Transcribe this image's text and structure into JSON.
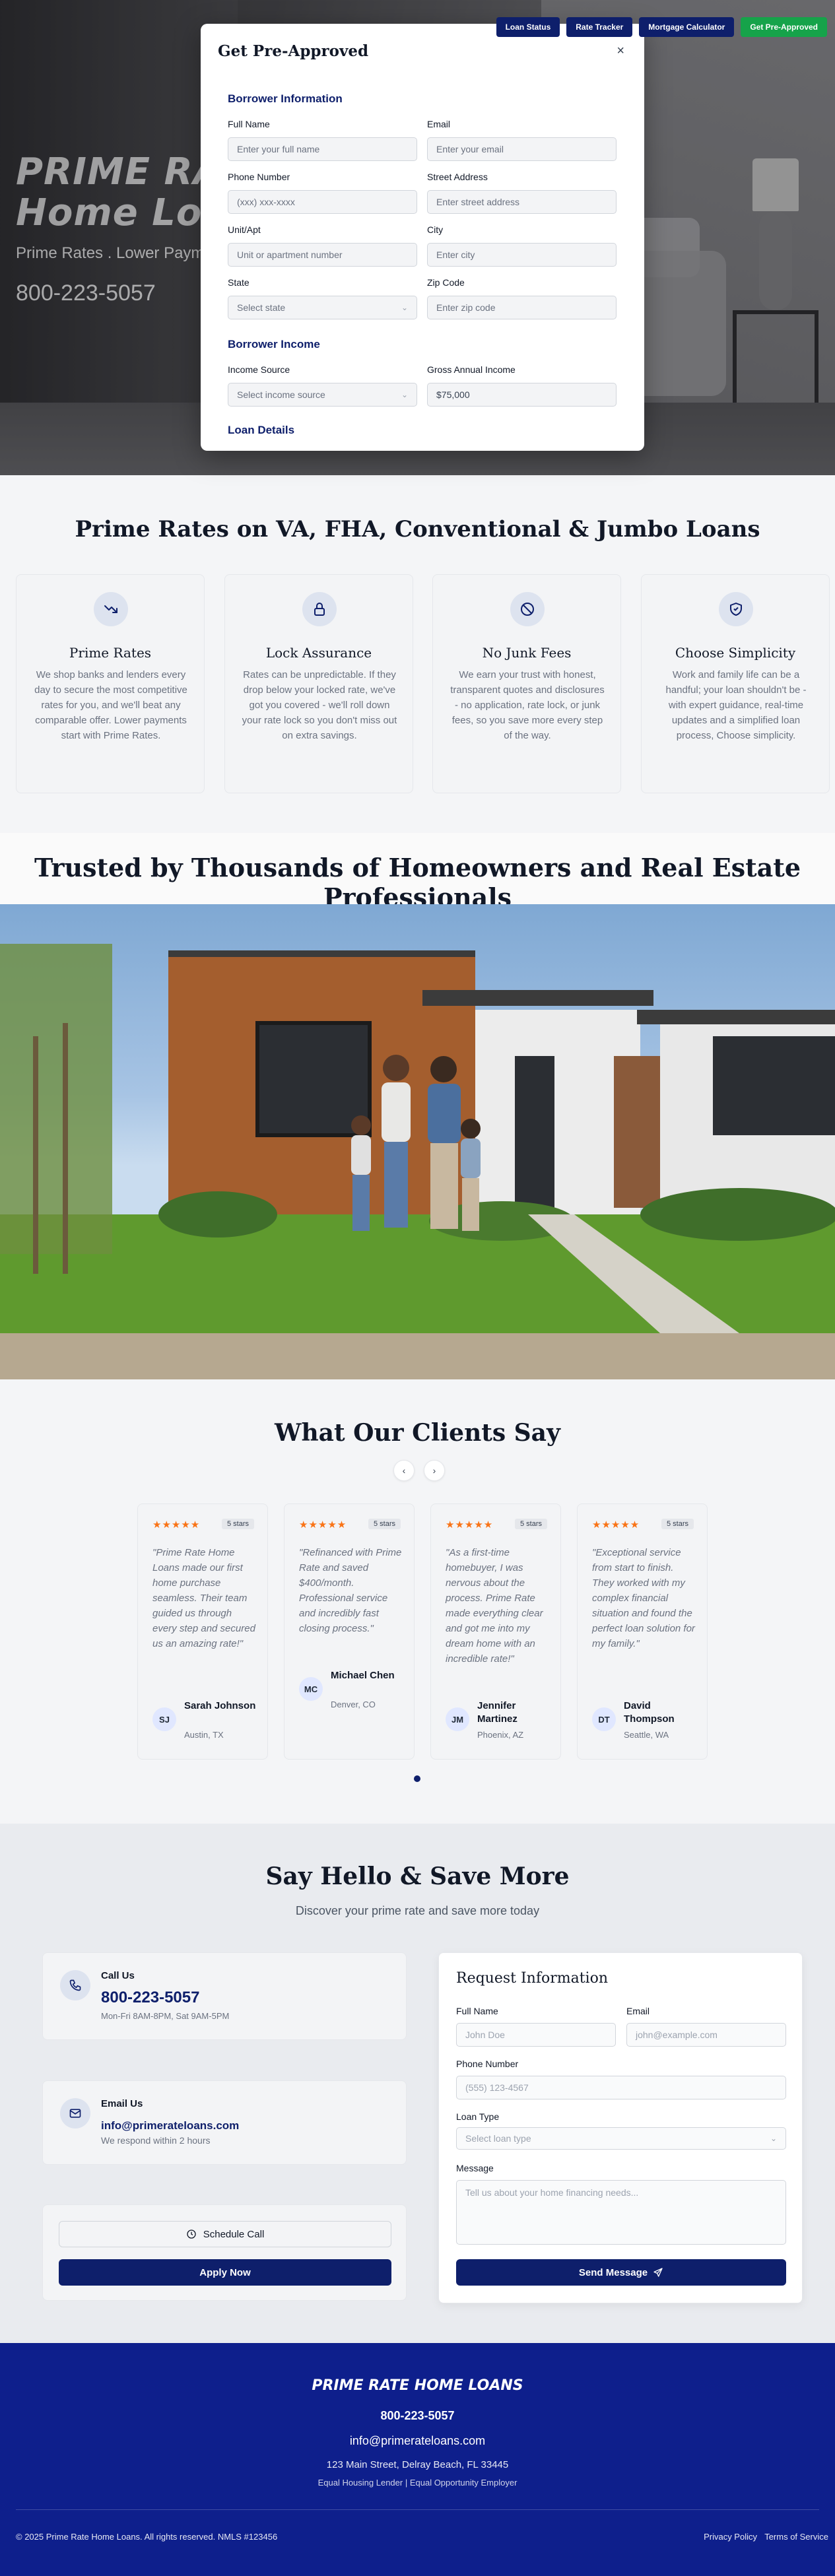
{
  "nav": {
    "loan_status": "Loan Status",
    "rate_tracker": "Rate Tracker",
    "mortgage_calculator": "Mortgage Calculator",
    "get_pre_approved": "Get Pre-Approved"
  },
  "hero": {
    "title_line1": "PRIME RA",
    "title_line2": "Home Loa",
    "subtitle": "Prime Rates . Lower Paym",
    "phone": "800-223-5057"
  },
  "modal": {
    "title": "Get Pre-Approved",
    "close": "×",
    "section_borrower": "Borrower Information",
    "full_name_label": "Full Name",
    "full_name_placeholder": "Enter your full name",
    "email_label": "Email",
    "email_placeholder": "Enter your email",
    "phone_label": "Phone Number",
    "phone_placeholder": "(xxx) xxx-xxxx",
    "street_label": "Street Address",
    "street_placeholder": "Enter street address",
    "unit_label": "Unit/Apt",
    "unit_placeholder": "Unit or apartment number",
    "city_label": "City",
    "city_placeholder": "Enter city",
    "state_label": "State",
    "state_placeholder": "Select state",
    "zip_label": "Zip Code",
    "zip_placeholder": "Enter zip code",
    "section_income": "Borrower Income",
    "income_source_label": "Income Source",
    "income_source_placeholder": "Select income source",
    "gross_income_label": "Gross Annual Income",
    "gross_income_value": "$75,000",
    "section_loan": "Loan Details"
  },
  "features": {
    "title": "Prime Rates on VA, FHA, Conventional & Jumbo Loans",
    "cards": [
      {
        "icon": "trending-down-icon",
        "title": "Prime Rates",
        "text": "We shop banks and lenders every day to secure the most competitive rates for you, and we'll beat any comparable offer. Lower payments start with Prime Rates."
      },
      {
        "icon": "lock-icon",
        "title": "Lock Assurance",
        "text": "Rates can be unpredictable. If they drop below your locked rate, we've got you covered - we'll roll down your rate lock so you don't miss out on extra savings."
      },
      {
        "icon": "ban-icon",
        "title": "No Junk Fees",
        "text": "We earn your trust with honest, transparent quotes and disclosures - no application, rate lock, or junk fees, so you save more every step of the way."
      },
      {
        "icon": "shield-heart-icon",
        "title": "Choose Simplicity",
        "text": "Work and family life can be a handful; your loan shouldn't be - with expert guidance, real-time updates and a simplified loan process, Choose simplicity."
      }
    ]
  },
  "trusted": {
    "title": "Trusted by Thousands of Homeowners and Real Estate Professionals"
  },
  "testimonials": {
    "title": "What Our Clients Say",
    "prev": "‹",
    "next": "›",
    "items": [
      {
        "stars": "★★★★★",
        "badge": "5 stars",
        "quote": "\"Prime Rate Home Loans made our first home purchase seamless. Their team guided us through every step and secured us an amazing rate!\"",
        "initials": "SJ",
        "name": "Sarah Johnson",
        "location": "Austin, TX"
      },
      {
        "stars": "★★★★★",
        "badge": "5 stars",
        "quote": "\"Refinanced with Prime Rate and saved $400/month. Professional service and incredibly fast closing process.\"",
        "initials": "MC",
        "name": "Michael Chen",
        "location": "Denver, CO"
      },
      {
        "stars": "★★★★★",
        "badge": "5 stars",
        "quote": "\"As a first-time homebuyer, I was nervous about the process. Prime Rate made everything clear and got me into my dream home with an incredible rate!\"",
        "initials": "JM",
        "name": "Jennifer Martinez",
        "location": "Phoenix, AZ"
      },
      {
        "stars": "★★★★★",
        "badge": "5 stars",
        "quote": "\"Exceptional service from start to finish. They worked with my complex financial situation and found the perfect loan solution for my family.\"",
        "initials": "DT",
        "name": "David Thompson",
        "location": "Seattle, WA"
      }
    ]
  },
  "contact": {
    "title": "Say Hello & Save More",
    "subtitle": "Discover your prime rate and save more today",
    "call_label": "Call Us",
    "call_phone": "800-223-5057",
    "call_hours": "Mon-Fri 8AM-8PM, Sat 9AM-5PM",
    "email_label": "Email Us",
    "email_address": "info@primerateloans.com",
    "email_note": "We respond within 2 hours",
    "schedule_call": "Schedule Call",
    "apply_now": "Apply Now",
    "form_title": "Request Information",
    "form_full_name_label": "Full Name",
    "form_full_name_placeholder": "John Doe",
    "form_email_label": "Email",
    "form_email_placeholder": "john@example.com",
    "form_phone_label": "Phone Number",
    "form_phone_placeholder": "(555) 123-4567",
    "form_loan_type_label": "Loan Type",
    "form_loan_type_placeholder": "Select loan type",
    "form_message_label": "Message",
    "form_message_placeholder": "Tell us about your home financing needs...",
    "send_message": "Send Message"
  },
  "footer": {
    "brand": "PRIME RATE HOME LOANS",
    "phone": "800-223-5057",
    "email": "info@primerateloans.com",
    "address": "123 Main Street, Delray Beach, FL 33445",
    "equal": "Equal Housing Lender | Equal Opportunity Employer",
    "copyright": "© 2025 Prime Rate Home Loans. All rights reserved. NMLS #123456",
    "privacy": "Privacy Policy",
    "terms": "Terms of Service"
  },
  "colors": {
    "navy": "#0e1f6b",
    "green": "#16a34a",
    "star": "#f97316",
    "footer": "#0e1f8c"
  }
}
